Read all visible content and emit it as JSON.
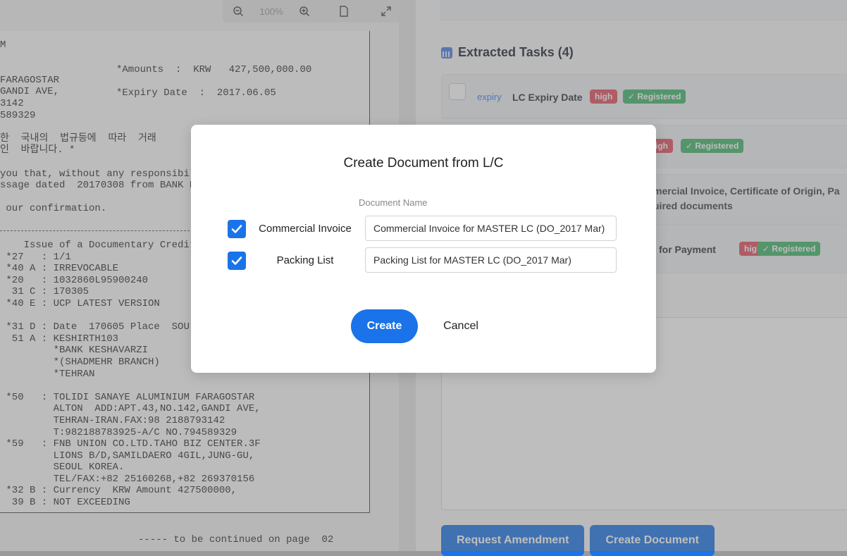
{
  "viewer": {
    "zoom_label": "100%",
    "scan_lines_left": [
      "M",
      "",
      "",
      "FARAGOSTAR",
      "GANDI AVE,",
      "3142",
      "589329",
      "",
      "한  국내의  법규등에  따라  거래",
      "인  바랍니다. *",
      "",
      "you that, without any responsibil",
      "ssage dated  20170308 from BANK K",
      "",
      " our confirmation."
    ],
    "scan_lines_right_top": [
      "*Amounts  :  KRW   427,500,000.00",
      "",
      "*Expiry Date  :  2017.06.05"
    ],
    "scan_fields": [
      "    Issue of a Documentary Credit",
      " *27   : 1/1",
      " *40 A : IRREVOCABLE",
      " *20   : 1032860L95900240",
      "  31 C : 170305",
      " *40 E : UCP LATEST VERSION",
      "",
      " *31 D : Date  170605 Place  SOU",
      "  51 A : KESHIRTH103",
      "         *BANK KESHAVARZI",
      "         *(SHADMEHR BRANCH)",
      "         *TEHRAN",
      "",
      " *50   : TOLIDI SANAYE ALUMINIUM FARAGOSTAR",
      "         ALTON  ADD:APT.43,NO.142,GANDI AVE,",
      "         TEHRAN-IRAN.FAX:98 2188793142",
      "         T:982188783925-A/C NO.794589329",
      " *59   : FNB UNION CO.LTD.TAHO BIZ CENTER.3F",
      "         LIONS B/D,SAMILDAERO 4GIL,JUNG-GU,",
      "         SEOUL KOREA.",
      "         TEL/FAX:+82 25160268,+82 269370156",
      " *32 B : Currency  KRW Amount 427500000,",
      "  39 B : NOT EXCEEDING"
    ],
    "footer": "----- to be continued on page  02"
  },
  "panel": {
    "tasks_title": "Extracted Tasks (4)",
    "tasks": [
      {
        "type": "expiry",
        "title": "LC Expiry Date",
        "priority": "high",
        "status": "✓ Registered"
      },
      {
        "type": "",
        "title": "",
        "priority": "igh",
        "status": "✓ Registered"
      },
      {
        "type": "",
        "title": "mercial Invoice, Certificate of Origin, Pa",
        "subtitle": "uired documents"
      },
      {
        "type": "",
        "title": "for Payment",
        "priority": "high",
        "status": "✓ Registered"
      }
    ],
    "buttons": {
      "request_amendment": "Request Amendment",
      "create_document": "Create Document"
    }
  },
  "modal": {
    "title": "Create Document from L/C",
    "column_label": "Document Name",
    "documents": [
      {
        "label": "Commercial Invoice",
        "checked": true,
        "name_value": "Commercial Invoice for MASTER LC (DO_2017 Mar)"
      },
      {
        "label": "Packing List",
        "checked": true,
        "name_value": "Packing List for MASTER LC (DO_2017 Mar)"
      }
    ],
    "create_label": "Create",
    "cancel_label": "Cancel"
  }
}
